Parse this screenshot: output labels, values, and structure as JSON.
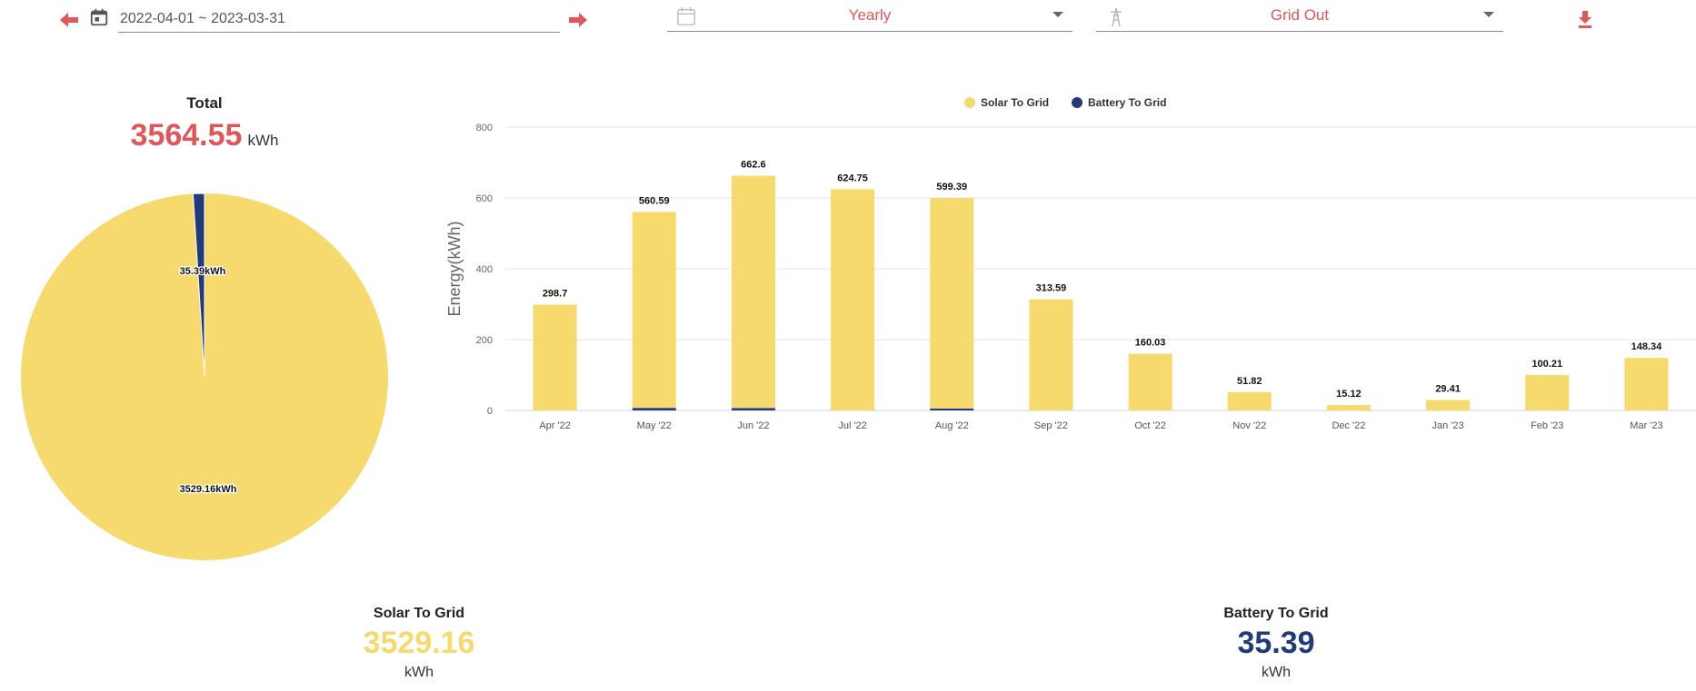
{
  "toolbar": {
    "date_range": "2022-04-01 ~ 2023-03-31",
    "period_selected": "Yearly",
    "metric_selected": "Grid Out"
  },
  "colors": {
    "accent": "#e15759",
    "solar": "#f6da6e",
    "battery": "#213b7a"
  },
  "total": {
    "label": "Total",
    "value": "3564.55",
    "unit": "kWh"
  },
  "pie": {
    "slices": [
      {
        "name": "Solar To Grid",
        "value": 3529.16,
        "label": "3529.16kWh",
        "color": "#f6da6e"
      },
      {
        "name": "Battery To Grid",
        "value": 35.39,
        "label": "35.39kWh",
        "color": "#213b7a"
      }
    ]
  },
  "chart_data": {
    "type": "bar",
    "stacked": true,
    "ylabel": "Energy(kWh)",
    "ylim": [
      0,
      800
    ],
    "yticks": [
      0,
      200,
      400,
      600,
      800
    ],
    "grid": true,
    "legend_position": "top-center",
    "categories": [
      "Apr '22",
      "May '22",
      "Jun '22",
      "Jul '22",
      "Aug '22",
      "Sep '22",
      "Oct '22",
      "Nov '22",
      "Dec '22",
      "Jan '23",
      "Feb '23",
      "Mar '23"
    ],
    "totals": [
      "298.7",
      "560.59",
      "662.6",
      "624.75",
      "599.39",
      "313.59",
      "160.03",
      "51.82",
      "15.12",
      "29.41",
      "100.21",
      "148.34"
    ],
    "series": [
      {
        "name": "Solar To Grid",
        "color": "#f6da6e",
        "values": [
          298.7,
          553.4,
          655.8,
          624.75,
          594.0,
          313.59,
          160.03,
          51.82,
          15.12,
          29.41,
          100.21,
          148.34
        ]
      },
      {
        "name": "Battery To Grid",
        "color": "#213b7a",
        "values": [
          0,
          7.19,
          6.8,
          0,
          5.39,
          0,
          0,
          0,
          0,
          0,
          0,
          0
        ]
      }
    ]
  },
  "summary": [
    {
      "label": "Solar To Grid",
      "value": "3529.16",
      "unit": "kWh",
      "color": "#f6da6e"
    },
    {
      "label": "Battery To Grid",
      "value": "35.39",
      "unit": "kWh",
      "color": "#213b7a"
    }
  ]
}
